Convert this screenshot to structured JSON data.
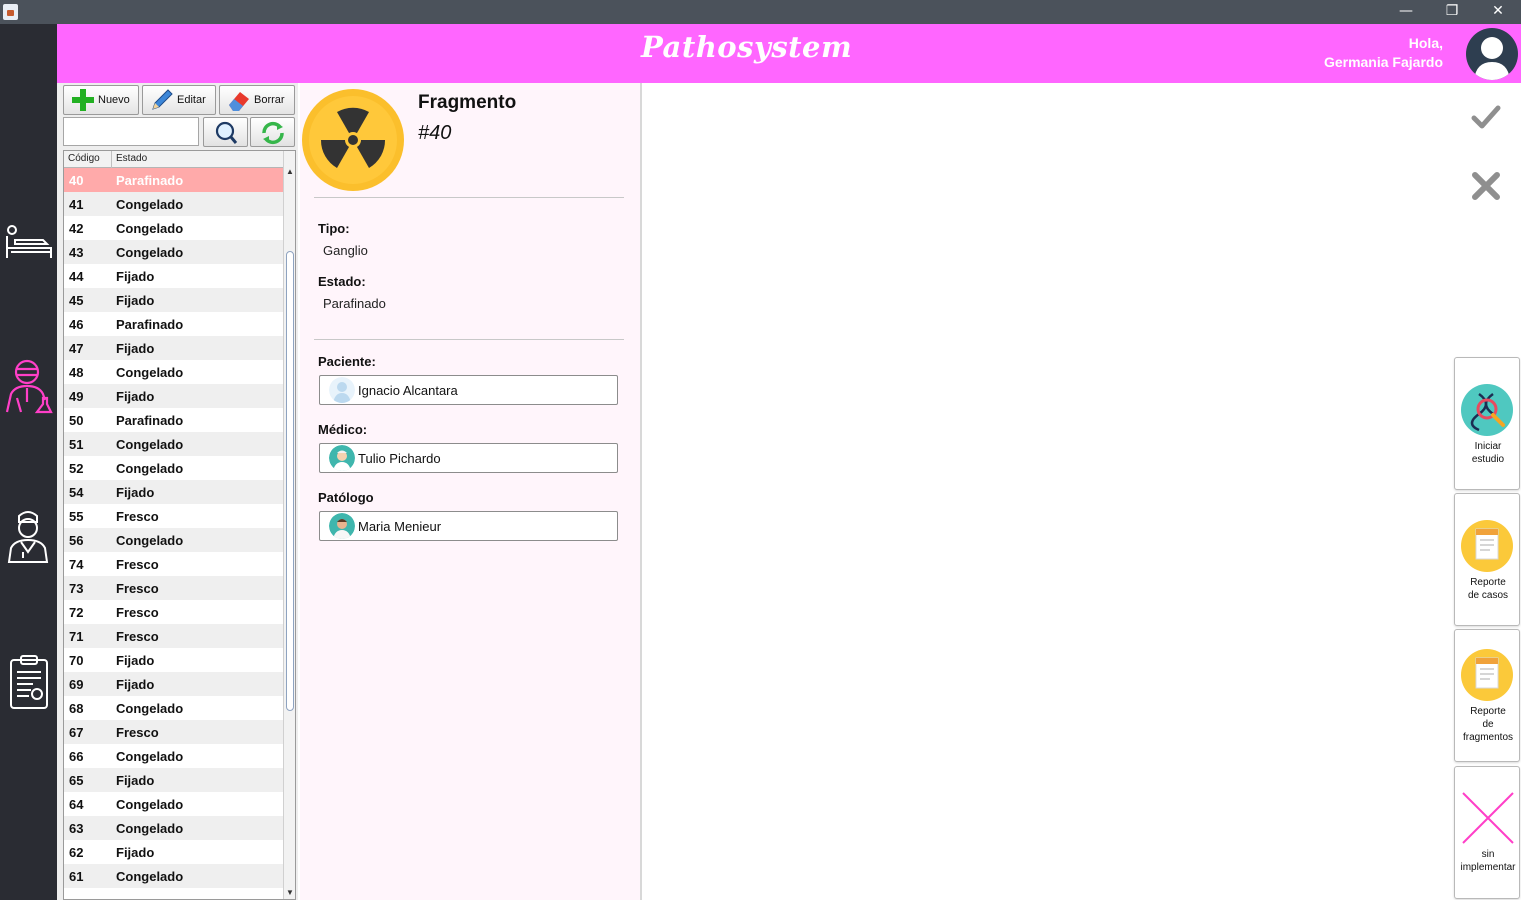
{
  "app": {
    "brand": "Pathosystem",
    "greeting_line1": "Hola,",
    "greeting_line2": "Germania Fajardo",
    "window_controls": {
      "minimize": "—",
      "maximize": "❐",
      "close": "✕"
    }
  },
  "toolbar": {
    "new_label": "Nuevo",
    "edit_label": "Editar",
    "delete_label": "Borrar",
    "search_value": ""
  },
  "table": {
    "headers": {
      "code": "Código",
      "state": "Estado"
    },
    "rows": [
      {
        "code": "40",
        "state": "Parafinado"
      },
      {
        "code": "41",
        "state": "Congelado"
      },
      {
        "code": "42",
        "state": "Congelado"
      },
      {
        "code": "43",
        "state": "Congelado"
      },
      {
        "code": "44",
        "state": "Fijado"
      },
      {
        "code": "45",
        "state": "Fijado"
      },
      {
        "code": "46",
        "state": "Parafinado"
      },
      {
        "code": "47",
        "state": "Fijado"
      },
      {
        "code": "48",
        "state": "Congelado"
      },
      {
        "code": "49",
        "state": "Fijado"
      },
      {
        "code": "50",
        "state": "Parafinado"
      },
      {
        "code": "51",
        "state": "Congelado"
      },
      {
        "code": "52",
        "state": "Congelado"
      },
      {
        "code": "54",
        "state": "Fijado"
      },
      {
        "code": "55",
        "state": "Fresco"
      },
      {
        "code": "56",
        "state": "Congelado"
      },
      {
        "code": "74",
        "state": "Fresco"
      },
      {
        "code": "73",
        "state": "Fresco"
      },
      {
        "code": "72",
        "state": "Fresco"
      },
      {
        "code": "71",
        "state": "Fresco"
      },
      {
        "code": "70",
        "state": "Fijado"
      },
      {
        "code": "69",
        "state": "Fijado"
      },
      {
        "code": "68",
        "state": "Congelado"
      },
      {
        "code": "67",
        "state": "Fresco"
      },
      {
        "code": "66",
        "state": "Congelado"
      },
      {
        "code": "65",
        "state": "Fijado"
      },
      {
        "code": "64",
        "state": "Congelado"
      },
      {
        "code": "63",
        "state": "Congelado"
      },
      {
        "code": "62",
        "state": "Fijado"
      },
      {
        "code": "61",
        "state": "Congelado"
      }
    ]
  },
  "detail": {
    "title": "Fragmento",
    "number": "#40",
    "tipo_label": "Tipo:",
    "tipo_value": "Ganglio",
    "estado_label": "Estado:",
    "estado_value": "Parafinado",
    "paciente_label": "Paciente:",
    "paciente_value": "Ignacio Alcantara",
    "medico_label": "Médico:",
    "medico_value": "Tulio Pichardo",
    "patologo_label": "Patólogo",
    "patologo_value": "Maria Menieur"
  },
  "actions": {
    "start_study": [
      "Iniciar",
      "estudio"
    ],
    "cases_report": [
      "Reporte",
      "de casos"
    ],
    "fragments_report": [
      "Reporte",
      "de",
      "fragmentos"
    ],
    "not_implemented": [
      "sin",
      "implementar"
    ]
  },
  "colors": {
    "header": "#ff66ff",
    "sidebar": "#2a2c33",
    "selected_row": "#ffaaaa",
    "detail_bg": "#fff5fb",
    "accent_icon": "#ff3fc8"
  }
}
